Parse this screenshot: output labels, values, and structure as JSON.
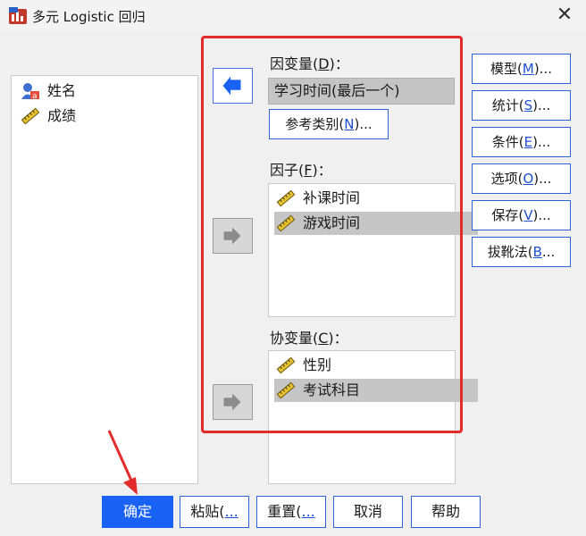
{
  "window": {
    "title": "多元 Logistic 回归",
    "close_glyph": "✕"
  },
  "source_list": {
    "items": [
      {
        "label": "姓名",
        "icon": "person-nominal-icon"
      },
      {
        "label": "成绩",
        "icon": "ruler-scale-icon"
      }
    ]
  },
  "dependent": {
    "label": "因变量(",
    "key": "D",
    "suffix": ")：",
    "value": "学习时间(最后一个)"
  },
  "reference_button": {
    "label": "参考类别(",
    "key": "N",
    "suffix": ")..."
  },
  "factors": {
    "label": "因子(",
    "key": "F",
    "suffix": ")：",
    "items": [
      {
        "label": "补课时间",
        "icon": "ruler-scale-icon",
        "selected": false
      },
      {
        "label": "游戏时间",
        "icon": "ruler-scale-icon",
        "selected": true
      }
    ]
  },
  "covariates": {
    "label": "协变量(",
    "key": "C",
    "suffix": ")：",
    "items": [
      {
        "label": "性别",
        "icon": "ruler-scale-icon",
        "selected": false
      },
      {
        "label": "考试科目",
        "icon": "ruler-scale-icon",
        "selected": true
      }
    ]
  },
  "side_buttons": [
    {
      "label": "模型(",
      "key": "M",
      "suffix": ")..."
    },
    {
      "label": "统计(",
      "key": "S",
      "suffix": ")..."
    },
    {
      "label": "条件(",
      "key": "E",
      "suffix": ")..."
    },
    {
      "label": "选项(",
      "key": "O",
      "suffix": ")..."
    },
    {
      "label": "保存(",
      "key": "V",
      "suffix": ")..."
    },
    {
      "label": "拔靴法(",
      "key": "B",
      "suffix": "..."
    }
  ],
  "bottom_buttons": {
    "ok": "确定",
    "paste": {
      "label": "粘贴(",
      "key": "..."
    },
    "reset": {
      "label": "重置(",
      "key": "..."
    },
    "cancel": "取消",
    "help": "帮助"
  },
  "colors": {
    "accent": "#1a62f5",
    "highlight": "#e32b2b",
    "selected": "#c6c6c6"
  }
}
